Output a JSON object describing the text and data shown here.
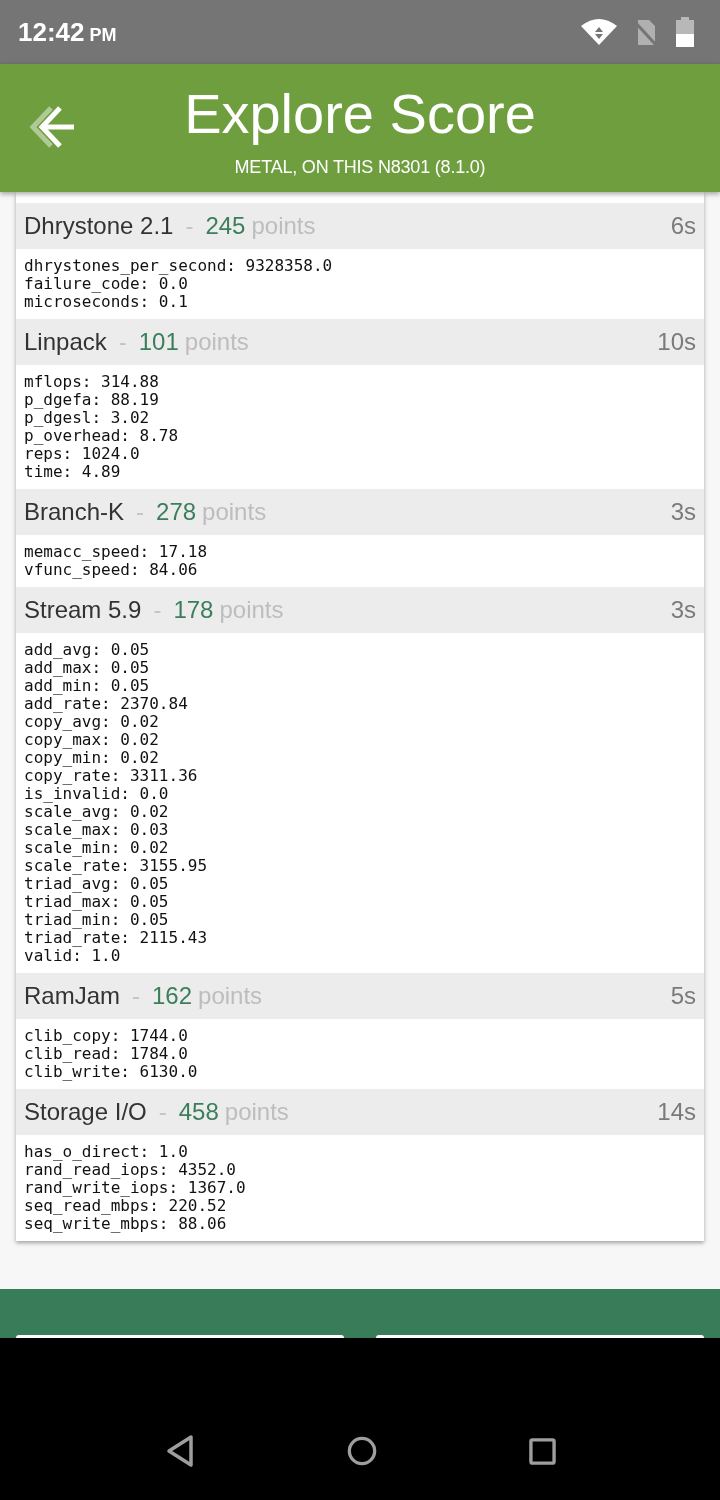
{
  "status_bar": {
    "time": "12:42",
    "meridiem": "PM"
  },
  "header": {
    "title": "Explore Score",
    "subtitle": "METAL, ON THIS N8301 (8.1.0)"
  },
  "results": [
    {
      "name": "Dhrystone 2.1",
      "separator": "-",
      "score": "245",
      "unit": "points",
      "duration": "6s",
      "lines": [
        "dhrystones_per_second: 9328358.0",
        "failure_code: 0.0",
        "microseconds: 0.1"
      ]
    },
    {
      "name": "Linpack",
      "separator": "-",
      "score": "101",
      "unit": "points",
      "duration": "10s",
      "lines": [
        "mflops: 314.88",
        "p_dgefa: 88.19",
        "p_dgesl: 3.02",
        "p_overhead: 8.78",
        "reps: 1024.0",
        "time: 4.89"
      ]
    },
    {
      "name": "Branch-K",
      "separator": "-",
      "score": "278",
      "unit": "points",
      "duration": "3s",
      "lines": [
        "memacc_speed: 17.18",
        "vfunc_speed: 84.06"
      ]
    },
    {
      "name": "Stream 5.9",
      "separator": "-",
      "score": "178",
      "unit": "points",
      "duration": "3s",
      "lines": [
        "add_avg: 0.05",
        "add_max: 0.05",
        "add_min: 0.05",
        "add_rate: 2370.84",
        "copy_avg: 0.02",
        "copy_max: 0.02",
        "copy_min: 0.02",
        "copy_rate: 3311.36",
        "is_invalid: 0.0",
        "scale_avg: 0.02",
        "scale_max: 0.03",
        "scale_min: 0.02",
        "scale_rate: 3155.95",
        "triad_avg: 0.05",
        "triad_max: 0.05",
        "triad_min: 0.05",
        "triad_rate: 2115.43",
        "valid: 1.0"
      ]
    },
    {
      "name": "RamJam",
      "separator": "-",
      "score": "162",
      "unit": "points",
      "duration": "5s",
      "lines": [
        "clib_copy: 1744.0",
        "clib_read: 1784.0",
        "clib_write: 6130.0"
      ]
    },
    {
      "name": "Storage I/O",
      "separator": "-",
      "score": "458",
      "unit": "points",
      "duration": "14s",
      "lines": [
        "has_o_direct: 1.0",
        "rand_read_iops: 4352.0",
        "rand_write_iops: 1367.0",
        "seq_read_mbps: 220.52",
        "seq_write_mbps: 88.06"
      ]
    }
  ]
}
